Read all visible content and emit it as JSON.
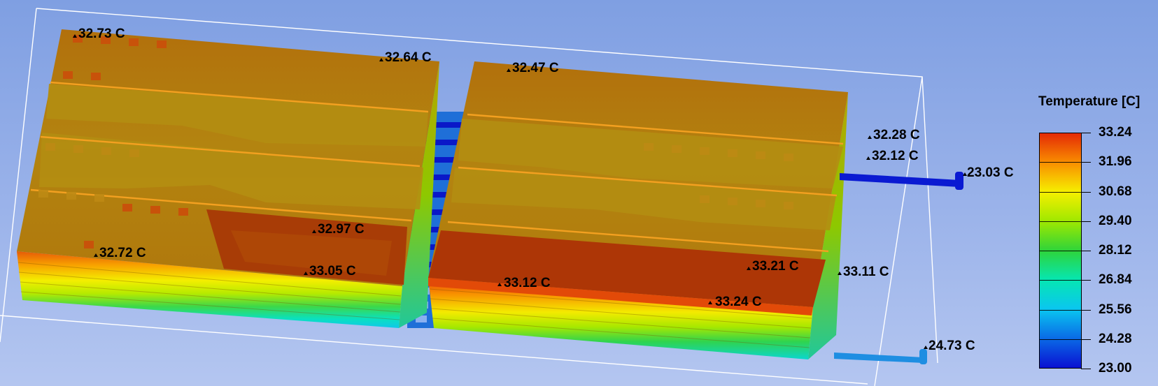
{
  "legend": {
    "title": "Temperature [C]",
    "ticks": [
      "33.24",
      "31.96",
      "30.68",
      "29.40",
      "28.12",
      "26.84",
      "25.56",
      "24.28",
      "23.00"
    ],
    "colors": [
      "#e42a06",
      "#f98e00",
      "#f6ef00",
      "#9fe800",
      "#2ed43a",
      "#06e6b2",
      "#0ac6f0",
      "#0a6ae6",
      "#0a10d2"
    ]
  },
  "probes": [
    {
      "id": "p1",
      "label": "32.73 C"
    },
    {
      "id": "p2",
      "label": "32.64 C"
    },
    {
      "id": "p3",
      "label": "32.47 C"
    },
    {
      "id": "p4",
      "label": "32.28 C"
    },
    {
      "id": "p5",
      "label": "32.12 C"
    },
    {
      "id": "p6",
      "label": "23.03 C"
    },
    {
      "id": "p7",
      "label": "32.97 C"
    },
    {
      "id": "p8",
      "label": "32.72 C"
    },
    {
      "id": "p9",
      "label": "33.05 C"
    },
    {
      "id": "p10",
      "label": "33.21 C"
    },
    {
      "id": "p11",
      "label": "33.11 C"
    },
    {
      "id": "p12",
      "label": "33.12 C"
    },
    {
      "id": "p13",
      "label": "33.24 C"
    },
    {
      "id": "p14",
      "label": "24.73 C"
    }
  ],
  "colors": {
    "background_top": "#7f9fe2",
    "background_bottom": "#b4c6f0",
    "module_top": "#b3720a",
    "module_top_light": "#b88e10",
    "module_hot": "#b03a06",
    "module_side": "#a8a000",
    "bounding_box": "#ffffff",
    "coolant_in": "#0a1ad2",
    "coolant_out": "#1e8ee2"
  }
}
